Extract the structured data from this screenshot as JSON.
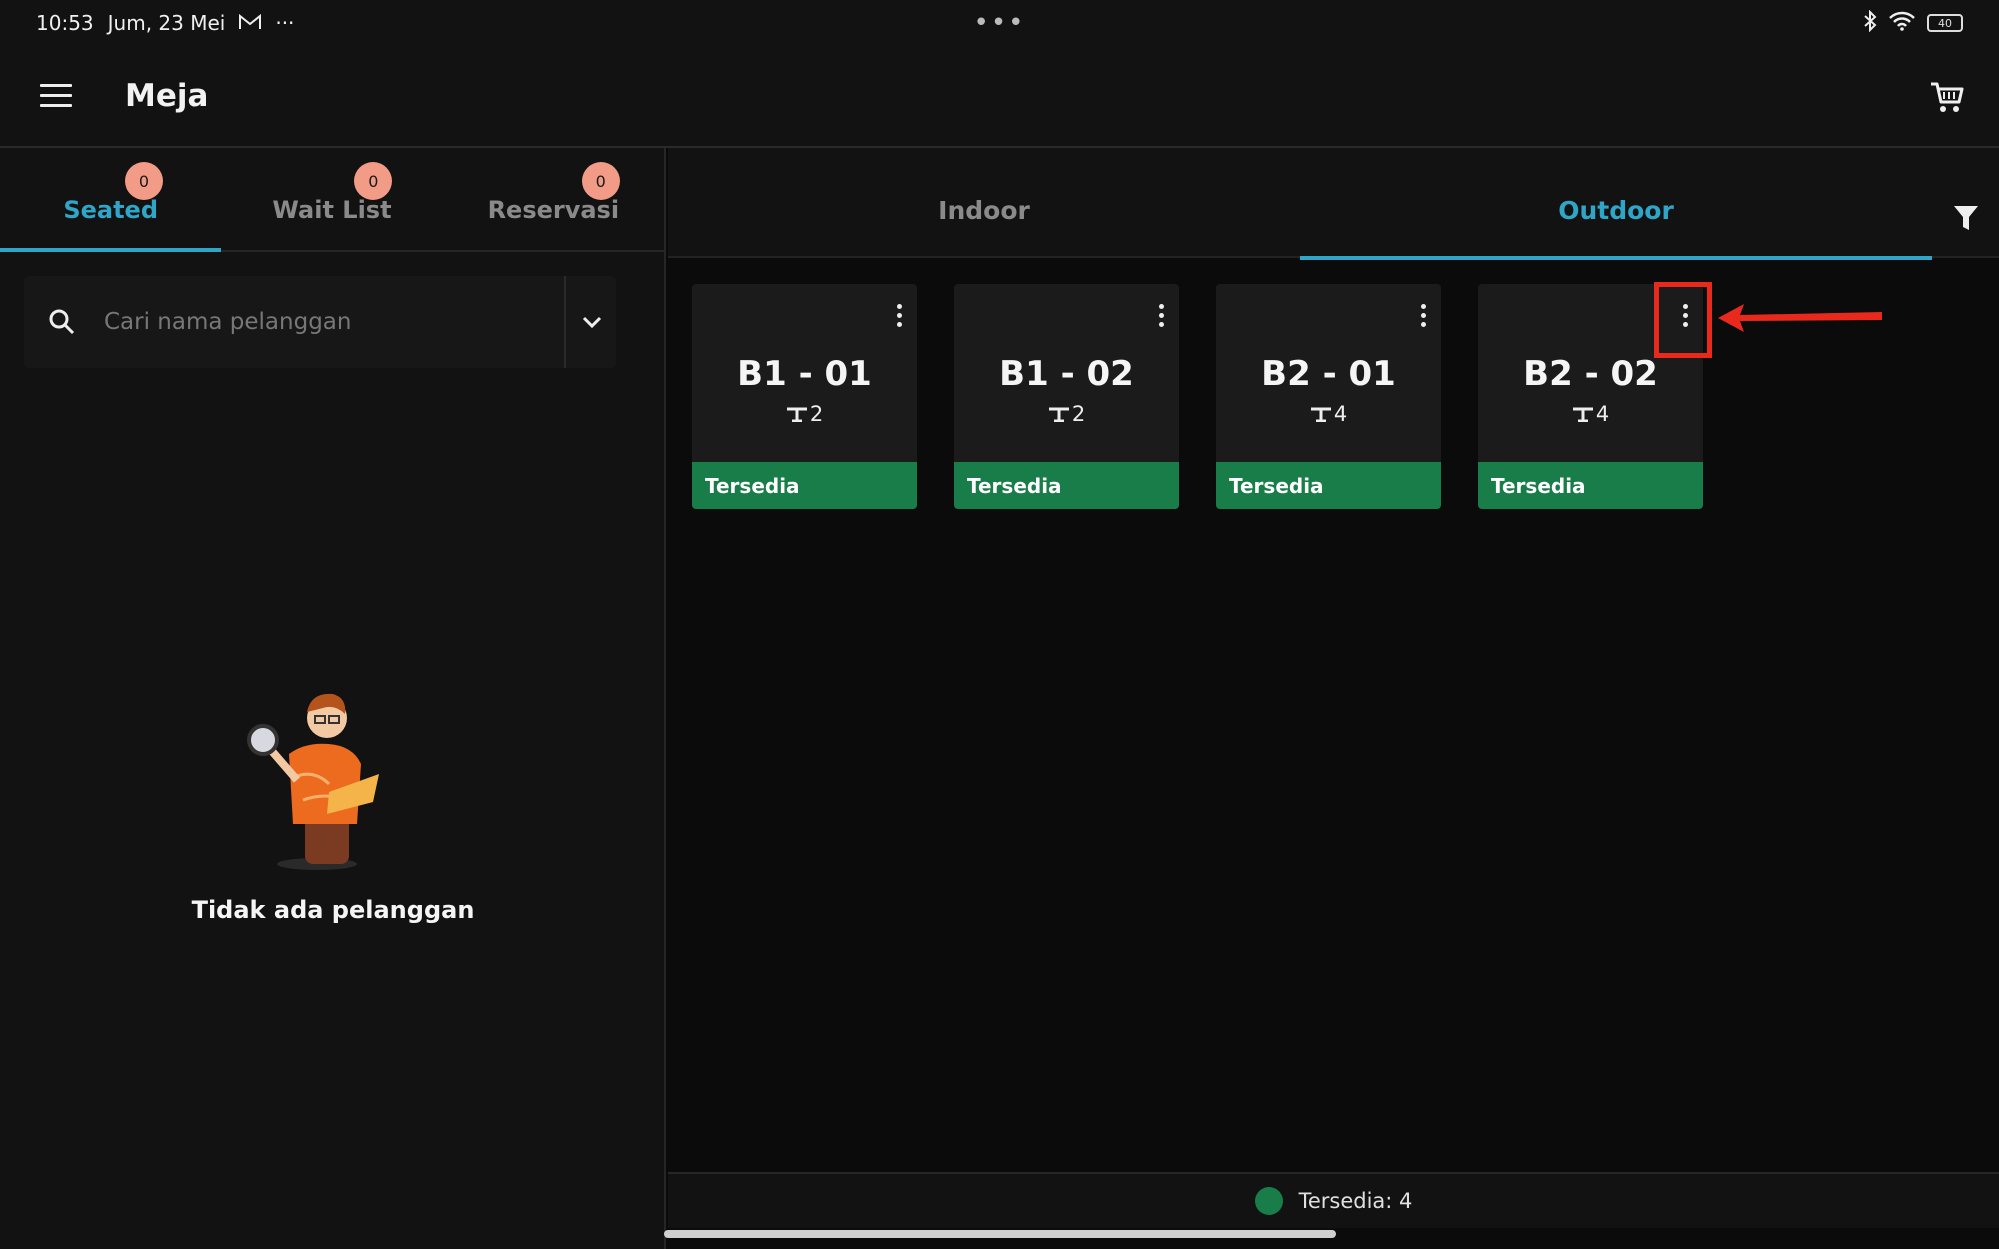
{
  "status_bar": {
    "time": "10:53",
    "date": "Jum, 23 Mei",
    "overflow": "···",
    "center_dots": "•••",
    "battery": "40"
  },
  "app_bar": {
    "title": "Meja"
  },
  "left_panel": {
    "tabs": [
      {
        "label": "Seated",
        "badge": "0",
        "active": true
      },
      {
        "label": "Wait List",
        "badge": "0",
        "active": false
      },
      {
        "label": "Reservasi",
        "badge": "0",
        "active": false
      }
    ],
    "search": {
      "placeholder": "Cari nama pelanggan",
      "value": ""
    },
    "empty_message": "Tidak ada pelanggan"
  },
  "right_panel": {
    "tabs": [
      {
        "label": "Indoor",
        "active": false
      },
      {
        "label": "Outdoor",
        "active": true
      }
    ],
    "tables": [
      {
        "name": "B1 - 01",
        "capacity": "2",
        "status": "Tersedia"
      },
      {
        "name": "B1 - 02",
        "capacity": "2",
        "status": "Tersedia"
      },
      {
        "name": "B2 - 01",
        "capacity": "4",
        "status": "Tersedia"
      },
      {
        "name": "B2 - 02",
        "capacity": "4",
        "status": "Tersedia"
      }
    ],
    "legend": {
      "text": "Tersedia: 4"
    }
  },
  "colors": {
    "accent": "#2fa5c8",
    "available": "#187d48",
    "badge": "#f29b86",
    "annotation": "#e8291c"
  }
}
